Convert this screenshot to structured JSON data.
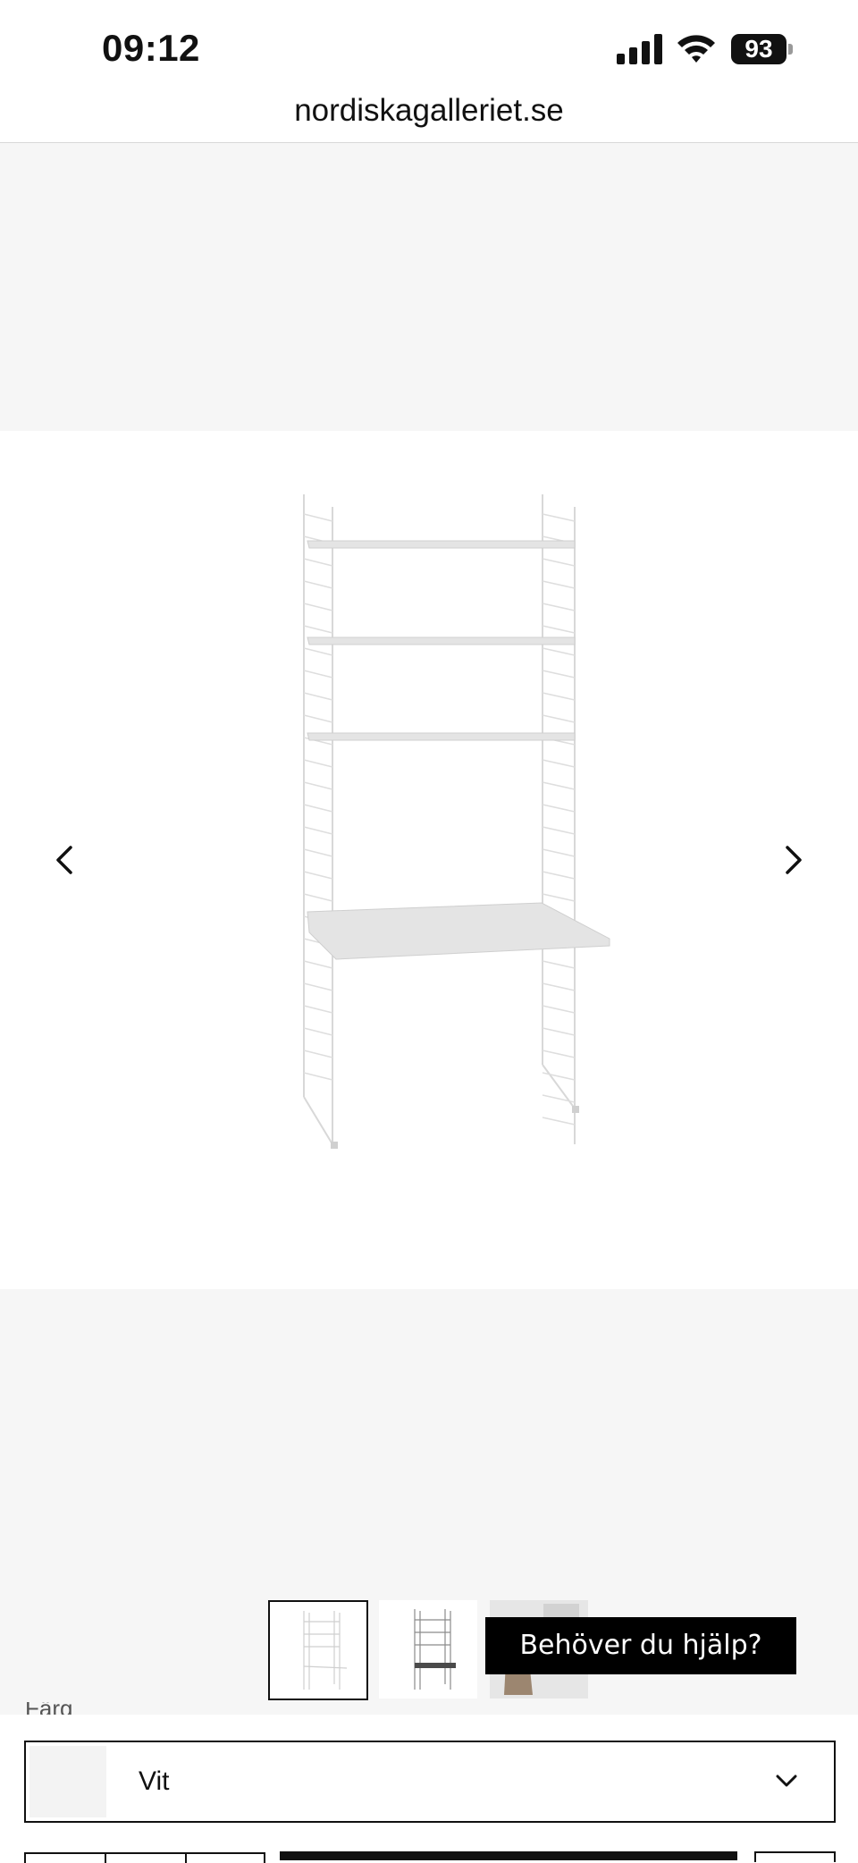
{
  "status_bar": {
    "time": "09:12",
    "battery": "93",
    "icons": [
      "signal-icon",
      "wifi-icon",
      "battery-icon"
    ]
  },
  "browser": {
    "url": "nordiskagalleriet.se"
  },
  "gallery": {
    "prev_icon": "chevron-left-icon",
    "next_icon": "chevron-right-icon",
    "thumbnails": [
      "thumbnail-white-desk",
      "thumbnail-dark-desk",
      "thumbnail-lifestyle"
    ]
  },
  "help": {
    "label": "Behöver du hjälp?"
  },
  "color_select": {
    "label": "Färg",
    "value": "Vit",
    "icon": "chevron-down-icon"
  },
  "colors": {
    "page_bg": "#ffffff",
    "panel_gray": "#f6f6f6",
    "text": "#111111",
    "help_bg": "#000000"
  }
}
